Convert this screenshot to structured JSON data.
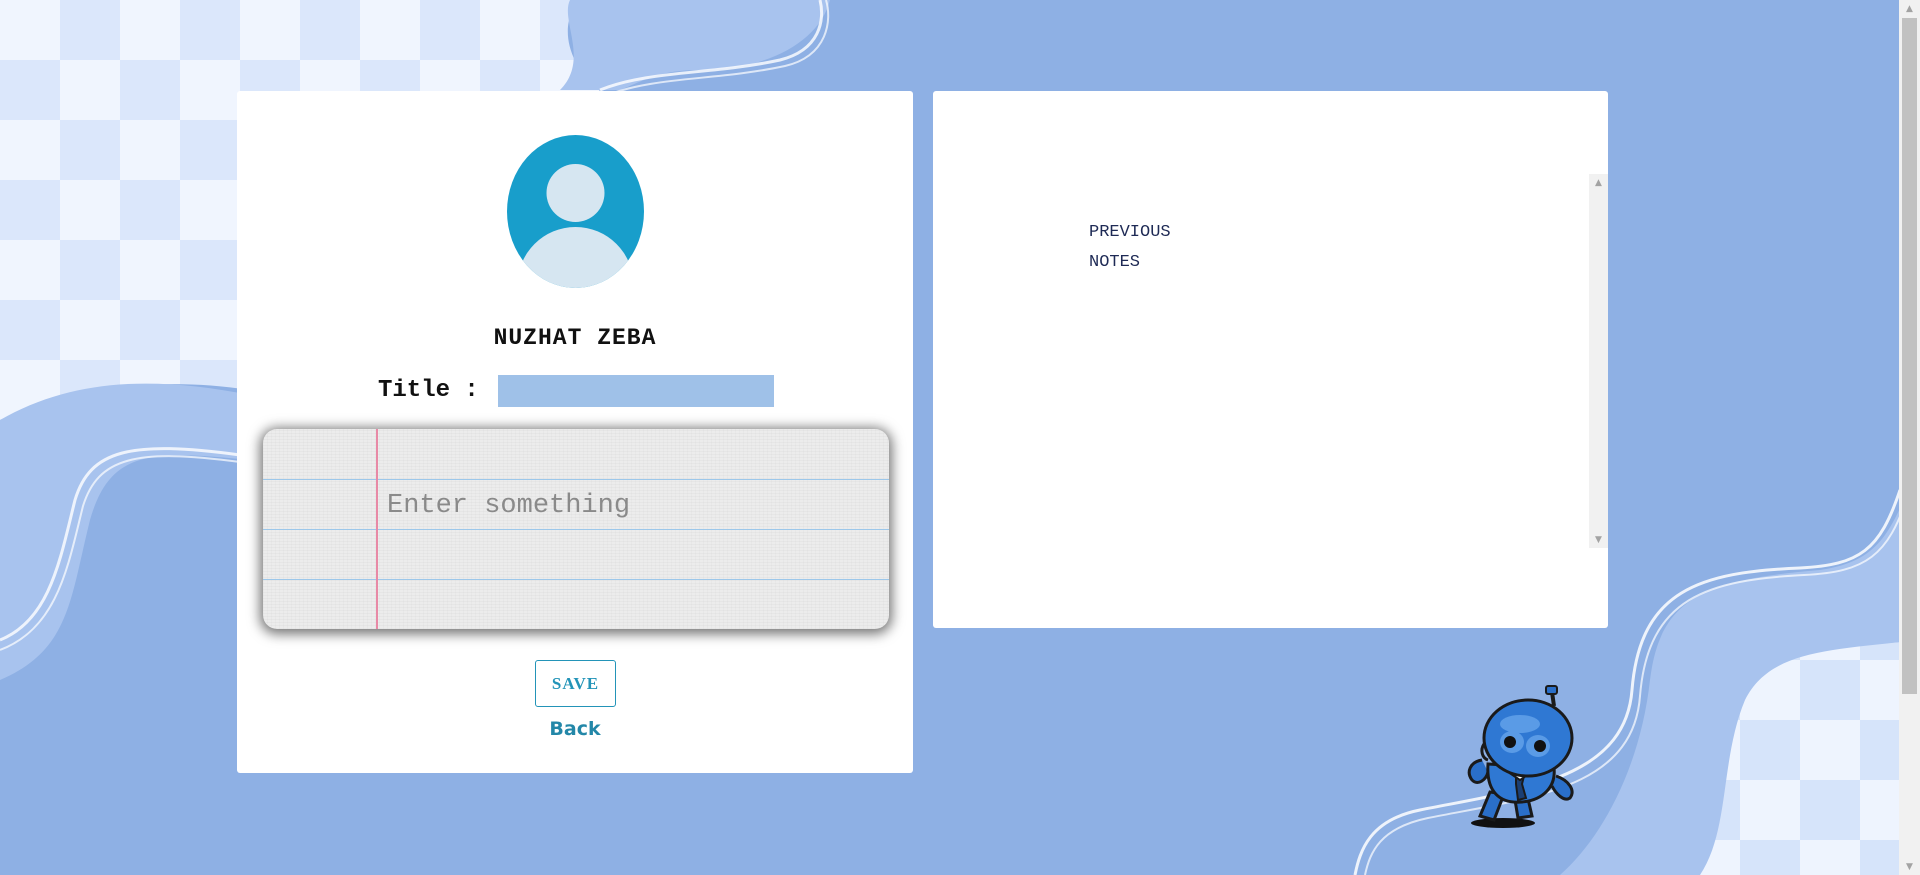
{
  "profile": {
    "name": "NUZHAT ZEBA"
  },
  "note_form": {
    "title_label": "Title :",
    "title_value": "",
    "body_placeholder": "Enter something",
    "save_label": "SAVE",
    "back_label": "Back"
  },
  "previous_notes": {
    "heading": "PREVIOUS NOTES",
    "items": []
  },
  "icons": {
    "avatar": "user-avatar-icon",
    "scroll_up": "triangle-up",
    "scroll_down": "triangle-down",
    "mascot": "robot-mascot"
  },
  "colors": {
    "page_background": "#8eb0e4",
    "accent": "#2394b8",
    "avatar": "#189ecb",
    "title_input": "#9fc1e8"
  }
}
